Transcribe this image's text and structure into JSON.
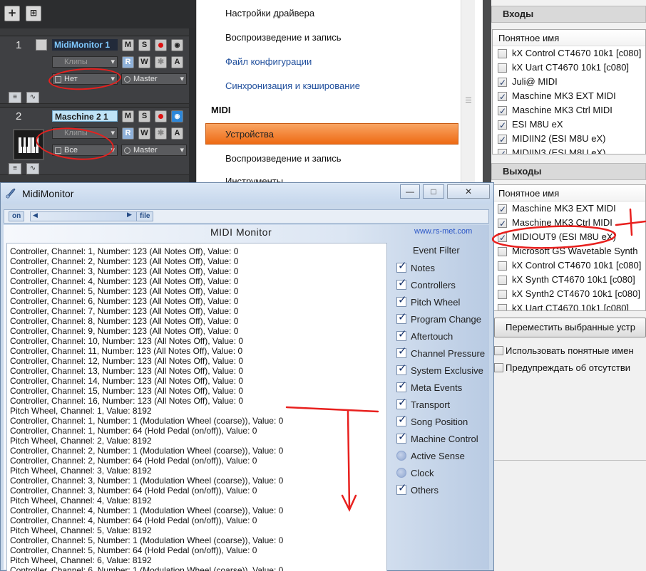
{
  "daw": {
    "add_label": "+",
    "tracks": [
      {
        "number": "1",
        "name": "MidiMonitor 1",
        "input": "Клипы",
        "midi_channel": "Нет",
        "output": "Master",
        "btn_m": "M",
        "btn_s": "S",
        "btn_r": "R",
        "btn_w": "W",
        "btn_a": "A"
      },
      {
        "number": "2",
        "name": "Maschine 2 1",
        "input": "Клипы",
        "midi_channel": "Все",
        "output": "Master",
        "btn_m": "M",
        "btn_s": "S",
        "btn_r": "R",
        "btn_w": "W",
        "btn_a": "A"
      }
    ]
  },
  "settings": {
    "items_top": [
      "Настройки драйвера",
      "Воспроизведение и запись",
      "Файл конфигурации",
      "Синхронизация и кэширование"
    ],
    "section_midi": "MIDI",
    "selected": "Устройства",
    "items_midi": [
      "Воспроизведение и запись",
      "Инструменты"
    ]
  },
  "devices": {
    "inputs_header": "Входы",
    "outputs_header": "Выходы",
    "column_header": "Понятное имя",
    "inputs": [
      {
        "name": "kX Control CT4670 10k1 [c080]",
        "checked": false
      },
      {
        "name": "kX Uart CT4670 10k1 [c080]",
        "checked": false
      },
      {
        "name": "Juli@ MIDI",
        "checked": true
      },
      {
        "name": "Maschine MK3 EXT MIDI",
        "checked": true
      },
      {
        "name": "Maschine MK3 Ctrl MIDI",
        "checked": true
      },
      {
        "name": "ESI M8U eX",
        "checked": true
      },
      {
        "name": "MIDIIN2 (ESI M8U eX)",
        "checked": true
      },
      {
        "name": "MIDIIN3 (ESI M8U eX)",
        "checked": true
      }
    ],
    "outputs": [
      {
        "name": "Maschine MK3 EXT MIDI",
        "checked": true
      },
      {
        "name": "Maschine MK3 Ctrl MIDI",
        "checked": true
      },
      {
        "name": "MIDIOUT9 (ESI M8U eX)",
        "checked": true
      },
      {
        "name": "Microsoft GS Wavetable Synth",
        "checked": false
      },
      {
        "name": "kX Control CT4670 10k1 [c080]",
        "checked": false
      },
      {
        "name": "kX Synth CT4670 10k1 [c080]",
        "checked": false
      },
      {
        "name": "kX Synth2 CT4670 10k1 [c080]",
        "checked": false
      },
      {
        "name": "kX Uart CT4670 10k1 [c080]",
        "checked": false
      }
    ],
    "move_button": "Переместить выбранные устр",
    "option_friendly": "Использовать понятные имен",
    "option_warn": "Предупреждать об отсутстви"
  },
  "monitor": {
    "window_title": "MidiMonitor",
    "btn_minimize": "—",
    "btn_maximize": "□",
    "btn_close": "✕",
    "toolbar_on": "on",
    "toolbar_file": "file",
    "heading": "MIDI Monitor",
    "link": "www.rs-met.com",
    "filter_title": "Event Filter",
    "filters": [
      {
        "label": "Notes",
        "checked": true
      },
      {
        "label": "Controllers",
        "checked": true
      },
      {
        "label": "Pitch Wheel",
        "checked": true
      },
      {
        "label": "Program Change",
        "checked": true
      },
      {
        "label": "Aftertouch",
        "checked": true
      },
      {
        "label": "Channel Pressure",
        "checked": true
      },
      {
        "label": "System Exclusive",
        "checked": true
      },
      {
        "label": "Meta Events",
        "checked": true
      },
      {
        "label": "Transport",
        "checked": true
      },
      {
        "label": "Song Position",
        "checked": true
      },
      {
        "label": "Machine Control",
        "checked": true
      },
      {
        "label": "Active Sense",
        "checked": false
      },
      {
        "label": "Clock",
        "checked": false
      },
      {
        "label": "Others",
        "checked": true
      }
    ],
    "log": [
      "Controller, Channel: 1, Number: 123 (All Notes Off), Value: 0",
      "Controller, Channel: 2, Number: 123 (All Notes Off), Value: 0",
      "Controller, Channel: 3, Number: 123 (All Notes Off), Value: 0",
      "Controller, Channel: 4, Number: 123 (All Notes Off), Value: 0",
      "Controller, Channel: 5, Number: 123 (All Notes Off), Value: 0",
      "Controller, Channel: 6, Number: 123 (All Notes Off), Value: 0",
      "Controller, Channel: 7, Number: 123 (All Notes Off), Value: 0",
      "Controller, Channel: 8, Number: 123 (All Notes Off), Value: 0",
      "Controller, Channel: 9, Number: 123 (All Notes Off), Value: 0",
      "Controller, Channel: 10, Number: 123 (All Notes Off), Value: 0",
      "Controller, Channel: 11, Number: 123 (All Notes Off), Value: 0",
      "Controller, Channel: 12, Number: 123 (All Notes Off), Value: 0",
      "Controller, Channel: 13, Number: 123 (All Notes Off), Value: 0",
      "Controller, Channel: 14, Number: 123 (All Notes Off), Value: 0",
      "Controller, Channel: 15, Number: 123 (All Notes Off), Value: 0",
      "Controller, Channel: 16, Number: 123 (All Notes Off), Value: 0",
      "Pitch Wheel, Channel: 1, Value: 8192",
      "Controller, Channel: 1, Number: 1 (Modulation Wheel (coarse)), Value: 0",
      "Controller, Channel: 1, Number: 64 (Hold Pedal (on/off)), Value: 0",
      "Pitch Wheel, Channel: 2, Value: 8192",
      "Controller, Channel: 2, Number: 1 (Modulation Wheel (coarse)), Value: 0",
      "Controller, Channel: 2, Number: 64 (Hold Pedal (on/off)), Value: 0",
      "Pitch Wheel, Channel: 3, Value: 8192",
      "Controller, Channel: 3, Number: 1 (Modulation Wheel (coarse)), Value: 0",
      "Controller, Channel: 3, Number: 64 (Hold Pedal (on/off)), Value: 0",
      "Pitch Wheel, Channel: 4, Value: 8192",
      "Controller, Channel: 4, Number: 1 (Modulation Wheel (coarse)), Value: 0",
      "Controller, Channel: 4, Number: 64 (Hold Pedal (on/off)), Value: 0",
      "Pitch Wheel, Channel: 5, Value: 8192",
      "Controller, Channel: 5, Number: 1 (Modulation Wheel (coarse)), Value: 0",
      "Controller, Channel: 5, Number: 64 (Hold Pedal (on/off)), Value: 0",
      "Pitch Wheel, Channel: 6, Value: 8192",
      "Controller, Channel: 6, Number: 1 (Modulation Wheel (coarse)), Value: 0"
    ]
  },
  "colors": {
    "selection_orange": "#ee6a14",
    "annotation_red": "#e8201e",
    "link_blue": "#1f4e9c"
  }
}
